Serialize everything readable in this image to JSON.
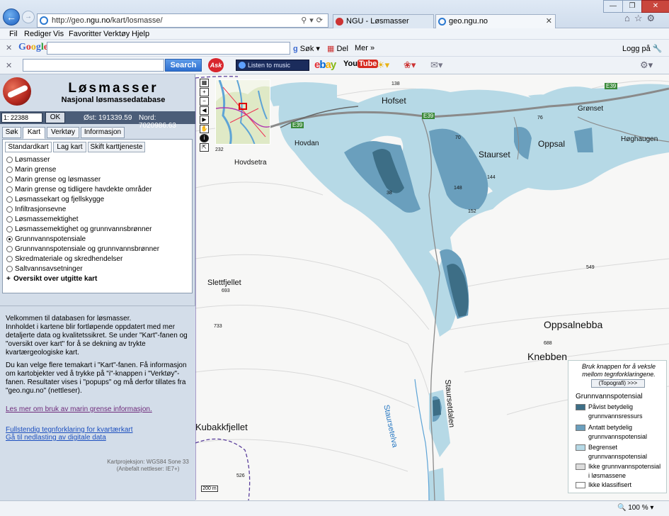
{
  "browser": {
    "address_scheme": "http://geo.",
    "address_host": "ngu.no",
    "address_path": "/kart/losmasse/",
    "tabs": [
      {
        "label": "NGU - Løsmasser"
      },
      {
        "label": "geo.ngu.no"
      }
    ],
    "menu": [
      "Fil",
      "Rediger",
      "Vis",
      "Favoritter",
      "Verktøy",
      "Hjelp"
    ],
    "google_logo": "Google",
    "google_search_label": "Søk",
    "google_del_label": "Del",
    "google_more_label": "Mer",
    "login_label": "Logg på",
    "ask_search_btn": "Search",
    "ask_logo": "Ask",
    "music_label": "Listen to music",
    "ebay_label": "ebay",
    "youtube_label_1": "You",
    "youtube_label_2": "Tube",
    "zoom": "100 %"
  },
  "app": {
    "title": "Løsmasser",
    "subtitle": "Nasjonal løsmassedatabase",
    "scale_value": "1: 22388",
    "ok_label": "OK",
    "east_label": "Øst: 191339.59",
    "north_label": "Nord: 7020986.63",
    "main_tabs": [
      "Søk",
      "Kart",
      "Verktøy",
      "Informasjon"
    ],
    "sub_tabs": [
      "Standardkart",
      "Lag kart",
      "Skift karttjeneste"
    ],
    "layers": [
      {
        "label": "Løsmasser",
        "selected": false
      },
      {
        "label": "Marin grense",
        "selected": false
      },
      {
        "label": "Marin grense og løsmasser",
        "selected": false
      },
      {
        "label": "Marin grense og tidligere havdekte områder",
        "selected": false
      },
      {
        "label": "Løsmassekart og fjellskygge",
        "selected": false
      },
      {
        "label": "Infiltrasjonsevne",
        "selected": false
      },
      {
        "label": "Løsmassemektighet",
        "selected": false
      },
      {
        "label": "Løsmassemektighet og grunnvannsbrønner",
        "selected": false
      },
      {
        "label": "Grunnvannspotensiale",
        "selected": true
      },
      {
        "label": "Grunnvannspotensiale og grunnvannsbrønner",
        "selected": false
      },
      {
        "label": "Skredmateriale og skredhendelser",
        "selected": false
      },
      {
        "label": "Saltvannsavsetninger",
        "selected": false
      }
    ],
    "overview_label": "Oversikt over utgitte kart",
    "welcome_1": "Velkommen til databasen for løsmasser.",
    "welcome_2": "Innholdet i kartene blir fortløpende oppdatert med mer detaljerte data og kvalitetssikret. Se under \"Kart\"-fanen og \"oversikt over kart\" for å se dekning av trykte kvartærgeologiske kart.",
    "welcome_3": "Du kan velge flere temakart i \"Kart\"-fanen. Få informasjon om kartobjekter ved å trykke på \"i\"-knappen i \"Verktøy\"-fanen. Resultater vises i \"popups\" og må derfor tillates fra \"geo.ngu.no\" (nettleser).",
    "link_marin": "Les mer om bruk av marin grense informasjon.",
    "link_legend": "Fullstendig tegnforklaring for kvartærkart",
    "link_download": "Gå til nedlasting av digitale data",
    "projection_1": "Kartprojeksjon: WGS84 Sone 33",
    "projection_2": "(Anbefalt nettleser: IE7+)"
  },
  "map": {
    "place_labels": [
      {
        "key": "hofset",
        "text": "Hofset"
      },
      {
        "key": "stuarset",
        "text": "Staurset"
      },
      {
        "key": "oppsal",
        "text": "Oppsal"
      },
      {
        "key": "gronset",
        "text": "Grønset"
      },
      {
        "key": "hoghaugen",
        "text": "Høghaugen"
      },
      {
        "key": "hovdan",
        "text": "Hovdan"
      },
      {
        "key": "hovdsetra",
        "text": "Hovdsetra"
      },
      {
        "key": "slettfjellet",
        "text": "Slettfjellet"
      },
      {
        "key": "oppsalnebba",
        "text": "Oppsalnebba"
      },
      {
        "key": "knebben",
        "text": "Knebben"
      },
      {
        "key": "kubakkfjellet",
        "text": "Kubakkfjellet"
      },
      {
        "key": "staursetelva",
        "text": "Staursetelva"
      },
      {
        "key": "staursetdalen",
        "text": "Staursetdalen"
      }
    ],
    "road_labels": [
      "E39",
      "E39",
      "E39"
    ],
    "heights": [
      "138",
      "232",
      "70",
      "76",
      "144",
      "148",
      "152",
      "38",
      "549",
      "693",
      "733",
      "688",
      "526"
    ],
    "scale_bar": "200 m",
    "legend": {
      "note": "Bruk knappen for å veksle mellom tegnforklaringene.",
      "button": "(Topografi) >>>",
      "title": "Grunnvannspotensial",
      "items": [
        {
          "line1": "Påvist betydelig",
          "line2": "grunnvannsressurs",
          "color": "#3d6e86"
        },
        {
          "line1": "Antatt betydelig",
          "line2": "grunnvannspotensial",
          "color": "#6a9fbd"
        },
        {
          "line1": "Begrenset",
          "line2": "grunnvannspotensial",
          "color": "#b6d9e6"
        },
        {
          "line1": "Ikke grunnvannspotensial",
          "line2": "i løsmassene",
          "color": "#dcdcdc"
        },
        {
          "line1": "Ikke klassifisert",
          "line2": "",
          "color": "#ffffff"
        }
      ]
    }
  }
}
